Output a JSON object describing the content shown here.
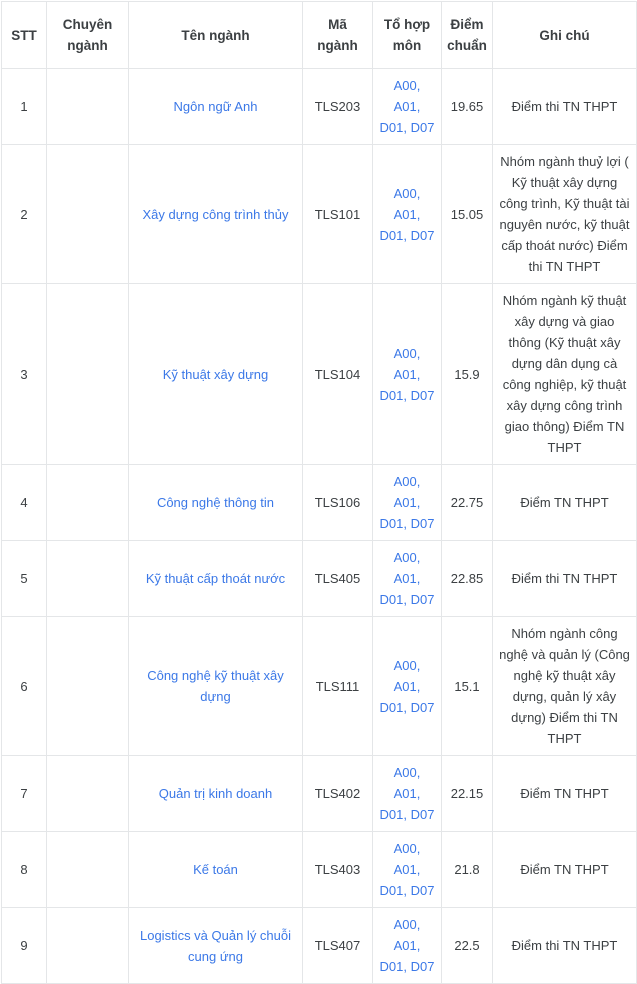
{
  "table": {
    "columns": [
      {
        "key": "stt",
        "label": "STT"
      },
      {
        "key": "chuyen",
        "label": "Chuyên ngành"
      },
      {
        "key": "ten",
        "label": "Tên ngành"
      },
      {
        "key": "ma",
        "label": "Mã ngành"
      },
      {
        "key": "tohop",
        "label": "Tổ hợp môn"
      },
      {
        "key": "diem",
        "label": "Điểm chuẩn"
      },
      {
        "key": "ghichu",
        "label": "Ghi chú"
      }
    ],
    "colors": {
      "link": "#3b78e7",
      "text": "#3c4043",
      "border": "#e4e6e8",
      "background": "#ffffff"
    },
    "rows": [
      {
        "stt": "1",
        "chuyen": "",
        "ten": "Ngôn ngữ Anh",
        "ma": "TLS203",
        "tohop": "A00, A01, D01, D07",
        "diem": "19.65",
        "ghichu": "Điểm thi TN THPT"
      },
      {
        "stt": "2",
        "chuyen": "",
        "ten": "Xây dựng công trình thủy",
        "ma": "TLS101",
        "tohop": "A00, A01, D01, D07",
        "diem": "15.05",
        "ghichu": "Nhóm ngành thuỷ lợi ( Kỹ thuật xây dựng công trình, Kỹ thuật tài nguyên nước, kỹ thuật cấp thoát nước) Điểm thi TN THPT"
      },
      {
        "stt": "3",
        "chuyen": "",
        "ten": "Kỹ thuật xây dựng",
        "ma": "TLS104",
        "tohop": "A00, A01, D01, D07",
        "diem": "15.9",
        "ghichu": "Nhóm ngành kỹ thuật xây dựng và giao thông (Kỹ thuật xây dựng dân dụng cà công nghiệp, kỹ thuật xây dựng công trình giao thông) Điểm TN THPT"
      },
      {
        "stt": "4",
        "chuyen": "",
        "ten": "Công nghệ thông tin",
        "ma": "TLS106",
        "tohop": "A00, A01, D01, D07",
        "diem": "22.75",
        "ghichu": "Điểm TN THPT"
      },
      {
        "stt": "5",
        "chuyen": "",
        "ten": "Kỹ thuật cấp thoát nước",
        "ma": "TLS405",
        "tohop": "A00, A01, D01, D07",
        "diem": "22.85",
        "ghichu": "Điểm thi TN THPT"
      },
      {
        "stt": "6",
        "chuyen": "",
        "ten": "Công nghệ kỹ thuật xây dựng",
        "ma": "TLS111",
        "tohop": "A00, A01, D01, D07",
        "diem": "15.1",
        "ghichu": "Nhóm ngành công nghệ và quản lý (Công nghệ kỹ thuật xây dựng, quản lý xây dựng) Điểm thi TN THPT"
      },
      {
        "stt": "7",
        "chuyen": "",
        "ten": "Quản trị kinh doanh",
        "ma": "TLS402",
        "tohop": "A00, A01, D01, D07",
        "diem": "22.15",
        "ghichu": "Điểm TN THPT"
      },
      {
        "stt": "8",
        "chuyen": "",
        "ten": "Kế toán",
        "ma": "TLS403",
        "tohop": "A00, A01, D01, D07",
        "diem": "21.8",
        "ghichu": "Điểm TN THPT"
      },
      {
        "stt": "9",
        "chuyen": "",
        "ten": "Logistics và Quản lý chuỗi cung ứng",
        "ma": "TLS407",
        "tohop": "A00, A01, D01, D07",
        "diem": "22.5",
        "ghichu": "Điểm thi TN THPT"
      }
    ]
  }
}
